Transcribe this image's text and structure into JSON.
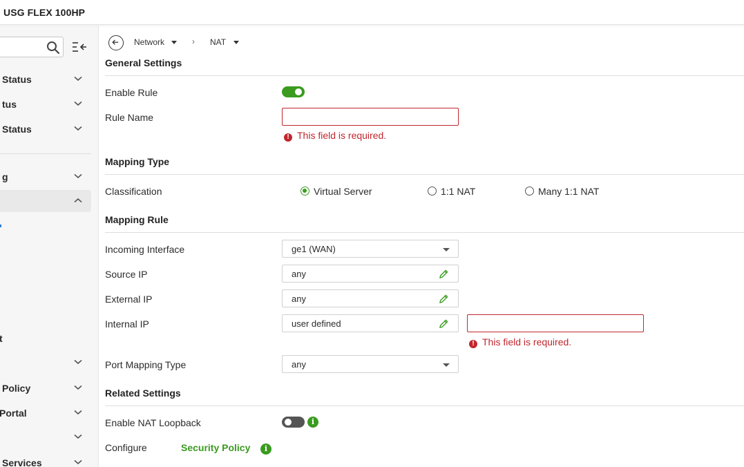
{
  "app": {
    "title": "USG FLEX 100HP"
  },
  "sidebar": {
    "search_placeholder": "",
    "items": [
      {
        "label": "Status",
        "expanded": false
      },
      {
        "label": "tus",
        "expanded": false
      },
      {
        "label": "Status",
        "expanded": false
      },
      {
        "label": "g",
        "expanded": false
      },
      {
        "label": "",
        "expanded": true
      },
      {
        "label": "t"
      },
      {
        "label": "",
        "expanded": false
      },
      {
        "label": "Policy",
        "expanded": false
      },
      {
        "label": "Portal",
        "expanded": false
      },
      {
        "label": "",
        "expanded": false
      },
      {
        "label": "Services",
        "expanded": false
      }
    ]
  },
  "breadcrumb": {
    "items": [
      "Network",
      "NAT"
    ],
    "separator": "›"
  },
  "general": {
    "title": "General Settings",
    "enable_rule_label": "Enable Rule",
    "enable_rule_on": true,
    "rule_name_label": "Rule Name",
    "rule_name_value": "",
    "rule_name_error": "This field is required."
  },
  "mapping_type": {
    "title": "Mapping Type",
    "classification_label": "Classification",
    "options": [
      "Virtual Server",
      "1:1 NAT",
      "Many 1:1 NAT"
    ],
    "selected": "Virtual Server"
  },
  "mapping_rule": {
    "title": "Mapping Rule",
    "incoming_interface_label": "Incoming Interface",
    "incoming_interface_value": "ge1 (WAN)",
    "source_ip_label": "Source IP",
    "source_ip_value": "any",
    "external_ip_label": "External IP",
    "external_ip_value": "any",
    "internal_ip_label": "Internal IP",
    "internal_ip_value": "user defined",
    "internal_ip_custom_value": "",
    "internal_ip_error": "This field is required.",
    "port_mapping_label": "Port Mapping Type",
    "port_mapping_value": "any"
  },
  "related": {
    "title": "Related Settings",
    "nat_loopback_label": "Enable NAT Loopback",
    "nat_loopback_on": false,
    "configure_label": "Configure",
    "security_policy_link": "Security Policy"
  },
  "icons": {
    "info": "i",
    "error": "!"
  },
  "colors": {
    "accent": "#3a9b1f",
    "error": "#c0262d",
    "toggle_off": "#555555"
  }
}
